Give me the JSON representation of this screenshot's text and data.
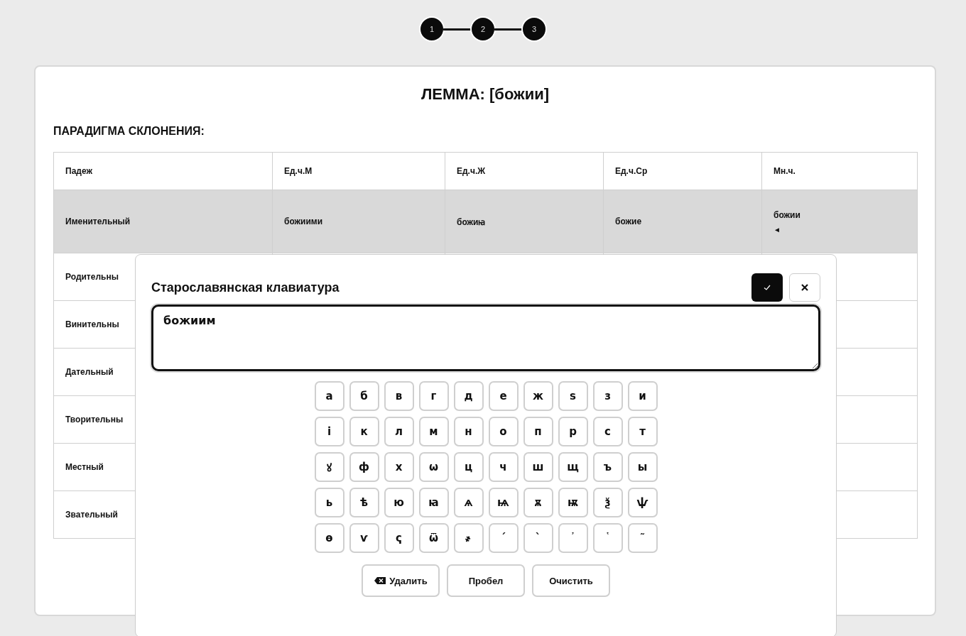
{
  "steps": [
    {
      "label": "1"
    },
    {
      "label": "2"
    },
    {
      "label": "3"
    }
  ],
  "title": "ЛЕММА: [божии]",
  "section_heading": "ПАРАДИГМА СКЛОНЕНИЯ:",
  "table": {
    "columns": [
      "Падеж",
      "Ед.ч.М",
      "Ед.ч.Ж",
      "Ед.ч.Ср",
      "Мн.ч."
    ],
    "rows": [
      {
        "selected": true,
        "cells": [
          "Именительный",
          "божиими",
          "божиꙗ",
          "божие",
          "божии"
        ],
        "marker": "◄"
      },
      {
        "selected": false,
        "cells": [
          "Родительны"
        ]
      },
      {
        "selected": false,
        "cells": [
          "Винительны"
        ]
      },
      {
        "selected": false,
        "cells": [
          "Дательный"
        ]
      },
      {
        "selected": false,
        "cells": [
          "Творительны"
        ]
      },
      {
        "selected": false,
        "cells": [
          "Местный"
        ]
      },
      {
        "selected": false,
        "cells": [
          "Звательный"
        ]
      }
    ]
  },
  "keyboard": {
    "title": "Старославянская клавиатура",
    "value": "божиим",
    "keys": [
      [
        "а",
        "б",
        "в",
        "г",
        "д",
        "е",
        "ж",
        "ѕ",
        "з",
        "и"
      ],
      [
        "і",
        "к",
        "л",
        "м",
        "н",
        "о",
        "п",
        "р",
        "с",
        "т"
      ],
      [
        "ꙋ",
        "ф",
        "х",
        "ѡ",
        "ц",
        "ч",
        "ш",
        "щ",
        "ъ",
        "ы"
      ],
      [
        "ь",
        "ѣ",
        "ю",
        "ꙗ",
        "ѧ",
        "ѩ",
        "ѫ",
        "ѭ",
        "ѯ",
        "ѱ"
      ],
      [
        "ѳ",
        "ѵ",
        "ҁ",
        "ѿ",
        "҂",
        "´",
        "`",
        "᾿",
        "῾",
        "˜"
      ]
    ],
    "actions": [
      {
        "kind": "delete",
        "label": "Удалить"
      },
      {
        "kind": "space",
        "label": "Пробел"
      },
      {
        "kind": "clear",
        "label": "Очистить"
      }
    ]
  }
}
